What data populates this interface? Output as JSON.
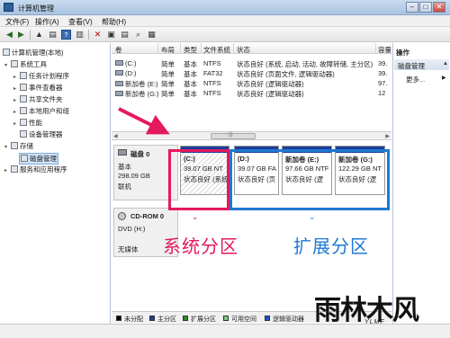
{
  "window": {
    "title": "计算机管理",
    "controls": [
      "–",
      "□",
      "✕"
    ]
  },
  "menu": [
    "文件(F)",
    "操作(A)",
    "查看(V)",
    "帮助(H)"
  ],
  "toolbar": {
    "icons": [
      "back-icon",
      "forward-icon",
      "up-icon",
      "show-tree-icon",
      "help-icon",
      "properties-icon",
      "delete-icon",
      "folder-icon",
      "save-icon",
      "search-icon",
      "view-icon"
    ],
    "glyphs": [
      "◀",
      "▶",
      "▲",
      "▤",
      "?",
      "▥",
      "✕",
      "▣",
      "▤",
      "⌕",
      "▦"
    ]
  },
  "tree": {
    "root": "计算机管理(本地)",
    "system_tools": "系统工具",
    "task_scheduler": "任务计划程序",
    "event_viewer": "事件查看器",
    "shared_folders": "共享文件夹",
    "local_users": "本地用户和组",
    "performance": "性能",
    "device_manager": "设备管理器",
    "storage": "存储",
    "disk_management": "磁盘管理",
    "services": "服务和应用程序"
  },
  "volume_table": {
    "headers": [
      "卷",
      "布局",
      "类型",
      "文件系统",
      "状态",
      "容量"
    ],
    "rows": [
      [
        "(C:)",
        "简单",
        "基本",
        "NTFS",
        "状态良好 (系统, 启动, 活动, 故障转储, 主分区)",
        "39."
      ],
      [
        "(D:)",
        "简单",
        "基本",
        "FAT32",
        "状态良好 (页面文件, 逻辑驱动器)",
        "39."
      ],
      [
        "新加卷 (E:)",
        "简单",
        "基本",
        "NTFS",
        "状态良好 (逻辑驱动器)",
        "97."
      ],
      [
        "新加卷 (G:)",
        "简单",
        "基本",
        "NTFS",
        "状态良好 (逻辑驱动器)",
        "12"
      ]
    ]
  },
  "scrollbar": {
    "thumb": "|||"
  },
  "disk0": {
    "name": "磁盘 0",
    "type": "基本",
    "size": "298.09 GB",
    "status": "联机",
    "partitions": [
      {
        "label": "(C:)",
        "size": "39.07 GB NT",
        "status": "状态良好 (系统",
        "color": "#1f3c9a"
      },
      {
        "label": "(D:)",
        "size": "39.07 GB FA",
        "status": "状态良好 (页",
        "color": "#1f3c9a"
      },
      {
        "label": "新加卷 (E:)",
        "size": "97.66 GB NTF",
        "status": "状态良好 (逻",
        "color": "#1f3c9a"
      },
      {
        "label": "新加卷 (G:)",
        "size": "122.29 GB NT",
        "status": "状态良好 (逻",
        "color": "#1f3c9a"
      }
    ]
  },
  "cdrom0": {
    "name": "CD-ROM 0",
    "drive": "DVD (H:)",
    "media": "无媒体"
  },
  "legend": [
    {
      "label": "未分配",
      "color": "#000000"
    },
    {
      "label": "主分区",
      "color": "#1f3c9a"
    },
    {
      "label": "扩展分区",
      "color": "#2f8a2f"
    },
    {
      "label": "可用空间",
      "color": "#7fc97f"
    },
    {
      "label": "逻辑驱动器",
      "color": "#2150c8"
    }
  ],
  "actions": {
    "header": "操作",
    "section": "磁盘管理",
    "more": "更多..."
  },
  "annotations": {
    "system_partition": "系统分区",
    "extended_partition": "扩展分区",
    "red": "#e5195e",
    "blue": "#1f78d1"
  },
  "watermark": {
    "big": "雨林木风",
    "small": "YLMF"
  }
}
